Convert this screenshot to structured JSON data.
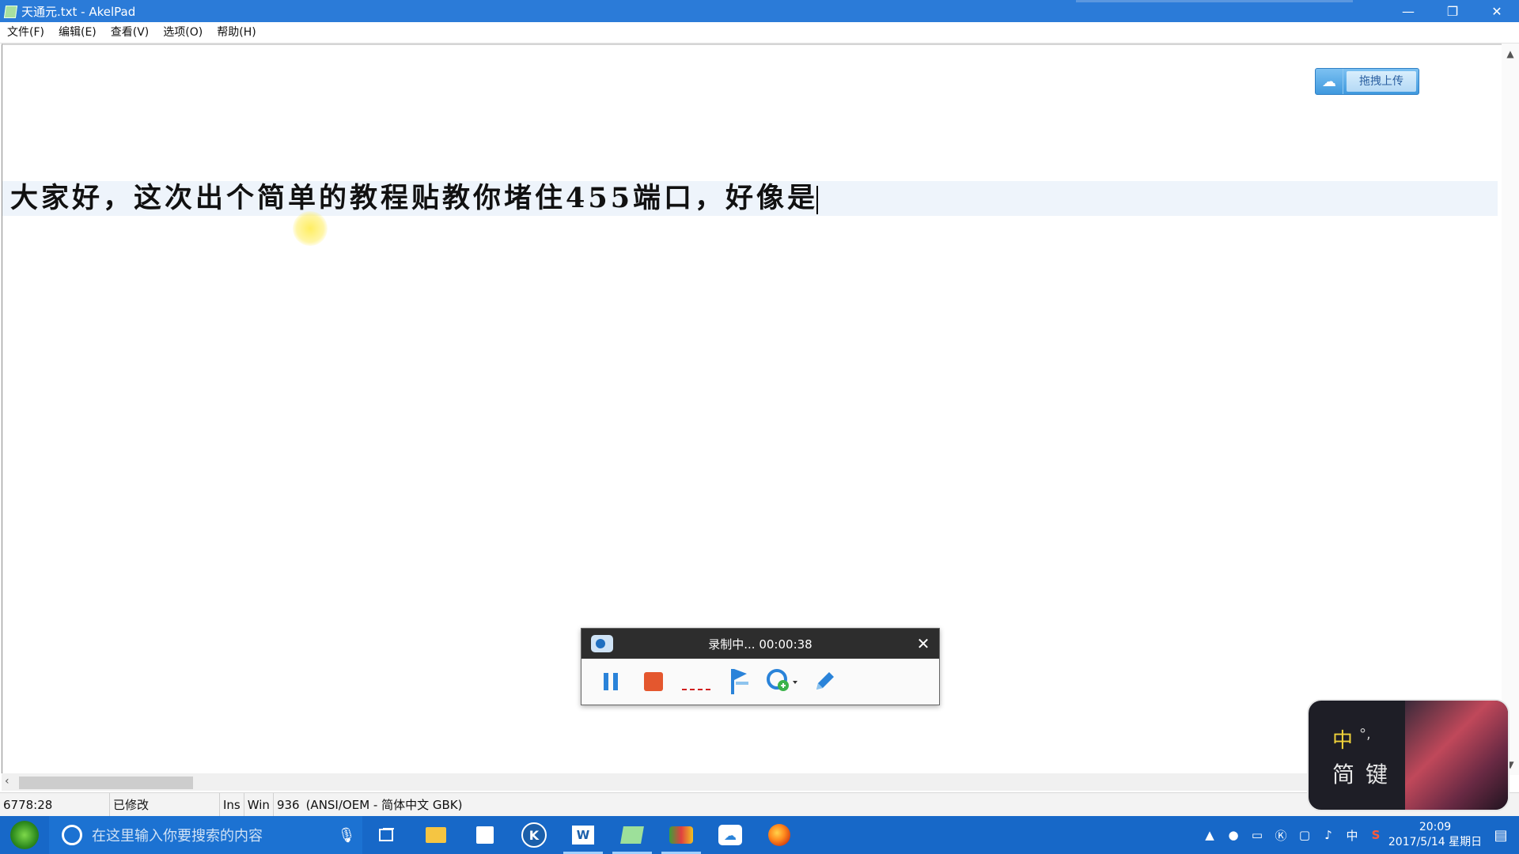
{
  "window": {
    "title": "天通元.txt - AkelPad",
    "controls": {
      "minimize": "—",
      "restore": "❐",
      "close": "✕"
    }
  },
  "menu": [
    "文件(F)",
    "编辑(E)",
    "查看(V)",
    "选项(O)",
    "帮助(H)"
  ],
  "editor": {
    "line_text": "大家好，这次出个简单的教程贴教你堵住455端口，好像是"
  },
  "upload_widget": {
    "label": "拖拽上传",
    "icon": "cloud-icon"
  },
  "scroll": {
    "up": "▲",
    "down": "▼",
    "left": "‹"
  },
  "statusbar": {
    "position": "6778:28",
    "modified": "已修改",
    "mode": "Ins",
    "newline": "Win",
    "codepage": "936",
    "encoding": "(ANSI/OEM - 简体中文 GBK)"
  },
  "recorder": {
    "status": "录制中... 00:00:38",
    "close": "✕",
    "tools": [
      "pause-icon",
      "stop-icon",
      "dash-line-icon",
      "flag-icon",
      "add-camera-icon",
      "pen-icon"
    ]
  },
  "ime": {
    "mode": "中",
    "punct": "°,",
    "labels": "简键"
  },
  "taskbar": {
    "search_placeholder": "在这里输入你要搜索的内容",
    "mic": "🎙",
    "apps": [
      "task-view-icon",
      "file-explorer-icon",
      "store-icon",
      "k-app-icon",
      "word-icon",
      "akelpad-icon",
      "camera-app-icon",
      "cloud-upload-icon",
      "firefox-icon"
    ],
    "tray": {
      "chevron": "▲",
      "ime": "中",
      "s_icon": "S"
    },
    "clock": {
      "time": "20:09",
      "date": "2017/5/14 星期日"
    }
  },
  "colors": {
    "titlebar": "#2b7bd8",
    "taskbar": "#1768c8",
    "line_highlight": "#eef4fb",
    "accent_yellow": "#f0d23a"
  }
}
